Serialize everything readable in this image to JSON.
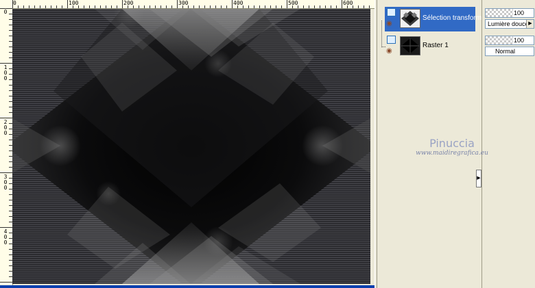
{
  "rulers": {
    "top_labels": [
      "0",
      "100",
      "200",
      "300",
      "400",
      "500",
      "600"
    ],
    "left_labels": [
      "0",
      "100",
      "200",
      "300",
      "400"
    ]
  },
  "layers": [
    {
      "name": "Sélection transform",
      "selected": true
    },
    {
      "name": "Raster 1",
      "selected": false
    }
  ],
  "properties": [
    {
      "opacity": "100",
      "blend_mode": "Lumière douce"
    },
    {
      "opacity": "100",
      "blend_mode": "Normal"
    }
  ],
  "watermark": {
    "name": "Pinuccia",
    "url": "www.maidiregrafica.eu"
  },
  "icons": {
    "visibility": "eye-icon",
    "layer_type": "raster-layer-icon",
    "collapse": "chevron-right-icon",
    "dropdown": "triangle-down-icon"
  },
  "colors": {
    "selection": "#316ac5",
    "panel": "#ece9d8",
    "canvas_dark": "#000000",
    "status_bar": "#0a3fae"
  }
}
